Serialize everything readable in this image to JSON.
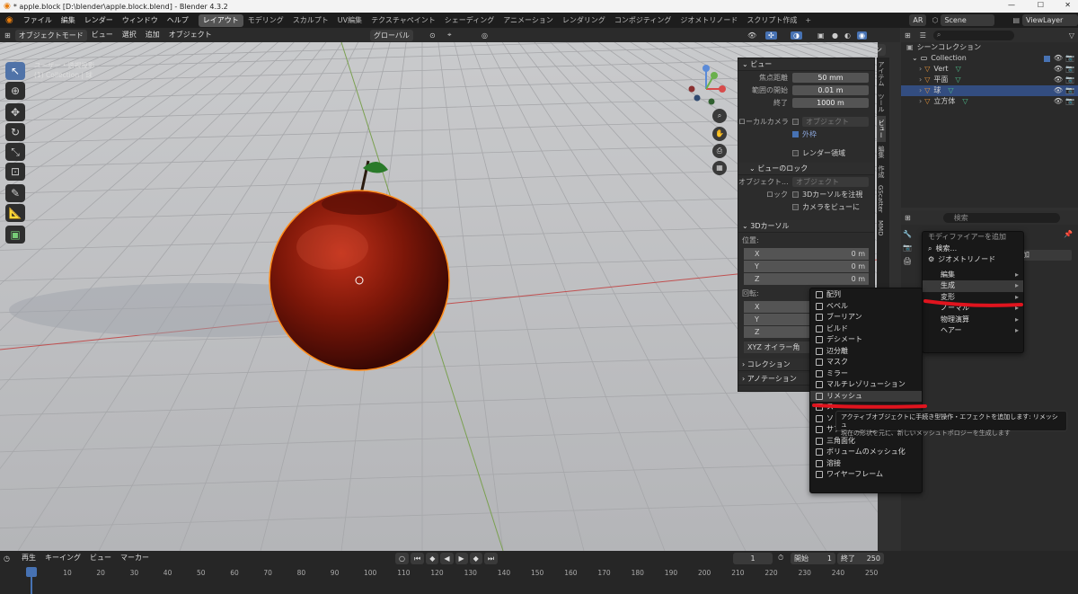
{
  "title": "* apple.block [D:\\blender\\apple.block.blend] - Blender 4.3.2",
  "menus": [
    "ファイル",
    "編集",
    "レンダー",
    "ウィンドウ",
    "ヘルプ"
  ],
  "workspaces": [
    "レイアウト",
    "モデリング",
    "スカルプト",
    "UV編集",
    "テクスチャペイント",
    "シェーディング",
    "アニメーション",
    "レンダリング",
    "コンポジティング",
    "ジオメトリノード",
    "スクリプト作成"
  ],
  "scene_lang": "AR",
  "scene": "Scene",
  "view_layer": "ViewLayer",
  "vp_header": {
    "mode": "オブジェクトモード",
    "view": "ビュー",
    "select": "選択",
    "add": "追加",
    "object": "オブジェクト",
    "orientation": "グローバル",
    "options": "オプション"
  },
  "vp_overlay": {
    "line1": "ユーザー・透視投影",
    "line2": "(1) Collection | 球"
  },
  "npanel": {
    "view_section": "ビュー",
    "focal_label": "焦点距離",
    "focal_value": "50 mm",
    "clip_start_label": "範囲の開始",
    "clip_start_value": "0.01 m",
    "clip_end_label": "終了",
    "clip_end_value": "1000 m",
    "local_camera_label": "ローカルカメラ",
    "local_camera_field": "オブジェクト",
    "outside_label": "外枠",
    "render_region_label": "レンダー領域",
    "lock_section": "ビューのロック",
    "lock_object_label": "オブジェクト...",
    "lock_object_field": "オブジェクト",
    "lock_label": "ロック",
    "lock_cursor": "3Dカーソルを注視",
    "lock_camera": "カメラをビューに",
    "cursor_section": "3Dカーソル",
    "location_label": "位置:",
    "x_label": "X",
    "x_value": "0 m",
    "y_label": "Y",
    "y_value": "0 m",
    "z_label": "Z",
    "z_value": "0 m",
    "rotation_label": "回転:",
    "rot_x": "X",
    "rot_y": "Y",
    "rot_z": "Z",
    "euler_label": "XYZ オイラー角",
    "collection_section": "コレクション",
    "annotation_section": "アノテーション"
  },
  "ntabs": [
    "アイテム",
    "ツール",
    "ビュー",
    "編集",
    "作成",
    "GScatter",
    "MMD"
  ],
  "outliner": {
    "search_placeholder": "",
    "root": "シーンコレクション",
    "collection": "Collection",
    "items": [
      {
        "name": "Vert",
        "selected": false
      },
      {
        "name": "平面",
        "selected": false
      },
      {
        "name": "球",
        "selected": true
      },
      {
        "name": "立方体",
        "selected": false
      }
    ]
  },
  "properties": {
    "search_placeholder": "検索",
    "add_modifier_partial": "加"
  },
  "add_modifier_menu": {
    "title": "モディファイアーを追加",
    "search": "検索...",
    "geometry_nodes": "ジオメトリノード",
    "items": [
      {
        "label": "編集",
        "sub": true
      },
      {
        "label": "生成",
        "sub": true,
        "active": true
      },
      {
        "label": "変形",
        "sub": true
      },
      {
        "label": "ノーマル",
        "sub": true
      },
      {
        "label": "物理演算",
        "sub": true
      },
      {
        "label": "ヘアー",
        "sub": true
      }
    ]
  },
  "generate_menu": {
    "items": [
      "配列",
      "ベベル",
      "ブーリアン",
      "ビルド",
      "デシメート",
      "辺分離",
      "マスク",
      "ミラー",
      "マルチレゾリューション",
      "リメッシュ",
      "ス",
      "ソ",
      "サブディビジョンサーフェス",
      "三角面化",
      "ボリュームのメッシュ化",
      "溶接",
      "ワイヤーフレーム"
    ],
    "highlighted": "リメッシュ"
  },
  "tooltip": {
    "line1": "アクティブオブジェクトに手続き型操作・エフェクトを追加します: リメッシュ",
    "line2": "現在の形状を元に、新しいメッシュトポロジーを生成します"
  },
  "timeline": {
    "playback": "再生",
    "keying": "キーイング",
    "view": "ビュー",
    "marker": "マーカー",
    "current_frame": "1",
    "start_label": "開始",
    "start": "1",
    "end_label": "終了",
    "end": "250",
    "ticks": [
      "1",
      "10",
      "20",
      "30",
      "40",
      "50",
      "60",
      "70",
      "80",
      "90",
      "100",
      "110",
      "120",
      "130",
      "140",
      "150",
      "160",
      "170",
      "180",
      "190",
      "200",
      "210",
      "220",
      "230",
      "240",
      "250"
    ]
  },
  "colors": {
    "accent": "#4772b3",
    "selection_outline": "#ff8c1a",
    "annotation_red": "#e0141e",
    "apple": "#8a1a0c"
  }
}
